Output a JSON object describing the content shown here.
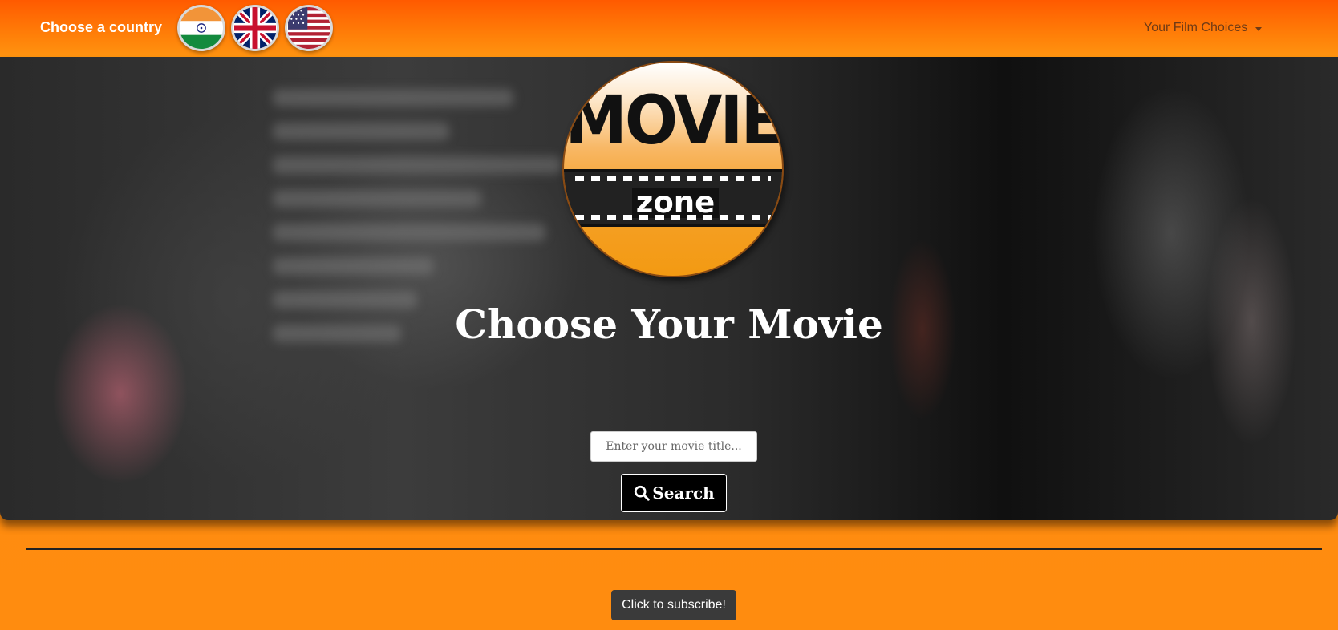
{
  "navbar": {
    "brand": "Choose a country",
    "flags": [
      {
        "name": "india-flag-icon",
        "country": "India"
      },
      {
        "name": "uk-flag-icon",
        "country": "United Kingdom"
      },
      {
        "name": "usa-flag-icon",
        "country": "United States"
      }
    ],
    "menu_label": "Your Film Choices"
  },
  "logo": {
    "title": "MOVIE",
    "subtitle": "zone"
  },
  "hero": {
    "title": "Choose Your Movie",
    "search": {
      "placeholder": "Enter your movie title...",
      "value": ""
    },
    "search_button": "Search"
  },
  "footer": {
    "subscribe_button": "Click to subscribe!"
  },
  "colors": {
    "navbar_top": "#ff5a00",
    "page_background": "#ff8c0f",
    "button_dark": "#000000",
    "subscribe_bg": "#3a3a3a"
  }
}
